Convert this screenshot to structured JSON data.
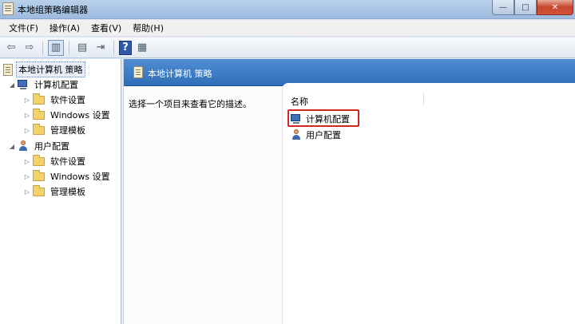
{
  "window": {
    "title": "本地组策略编辑器"
  },
  "window_buttons": {
    "minimize": "—",
    "maximize": "□",
    "close": "✕"
  },
  "menu": {
    "items": [
      "文件(F)",
      "操作(A)",
      "查看(V)",
      "帮助(H)"
    ]
  },
  "toolbar": {
    "icons": [
      "back-arrow-icon",
      "forward-arrow-icon",
      "show-hide-tree-icon",
      "properties-icon",
      "export-list-icon",
      "help-icon",
      "view-icon"
    ],
    "glyphs": [
      "⇦",
      "⇨",
      "▥",
      "▤",
      "⇥",
      "?",
      "▦"
    ]
  },
  "tree": {
    "root": "本地计算机 策略",
    "computer_config": {
      "label": "计算机配置",
      "children": [
        "软件设置",
        "Windows 设置",
        "管理模板"
      ]
    },
    "user_config": {
      "label": "用户配置",
      "children": [
        "软件设置",
        "Windows 设置",
        "管理模板"
      ]
    },
    "expanded_glyph": "◢",
    "collapsed_glyph": "▷"
  },
  "main": {
    "header_title": "本地计算机 策略",
    "description": "选择一个项目来查看它的描述。",
    "column_name": "名称",
    "items": [
      "计算机配置",
      "用户配置"
    ],
    "highlighted_item": "计算机配置",
    "highlight_color": "#d0281e"
  },
  "colors": {
    "header_band": "#2f6fb9",
    "titlebar": "#b9d1ea",
    "selection_border": "#6a86ad"
  }
}
